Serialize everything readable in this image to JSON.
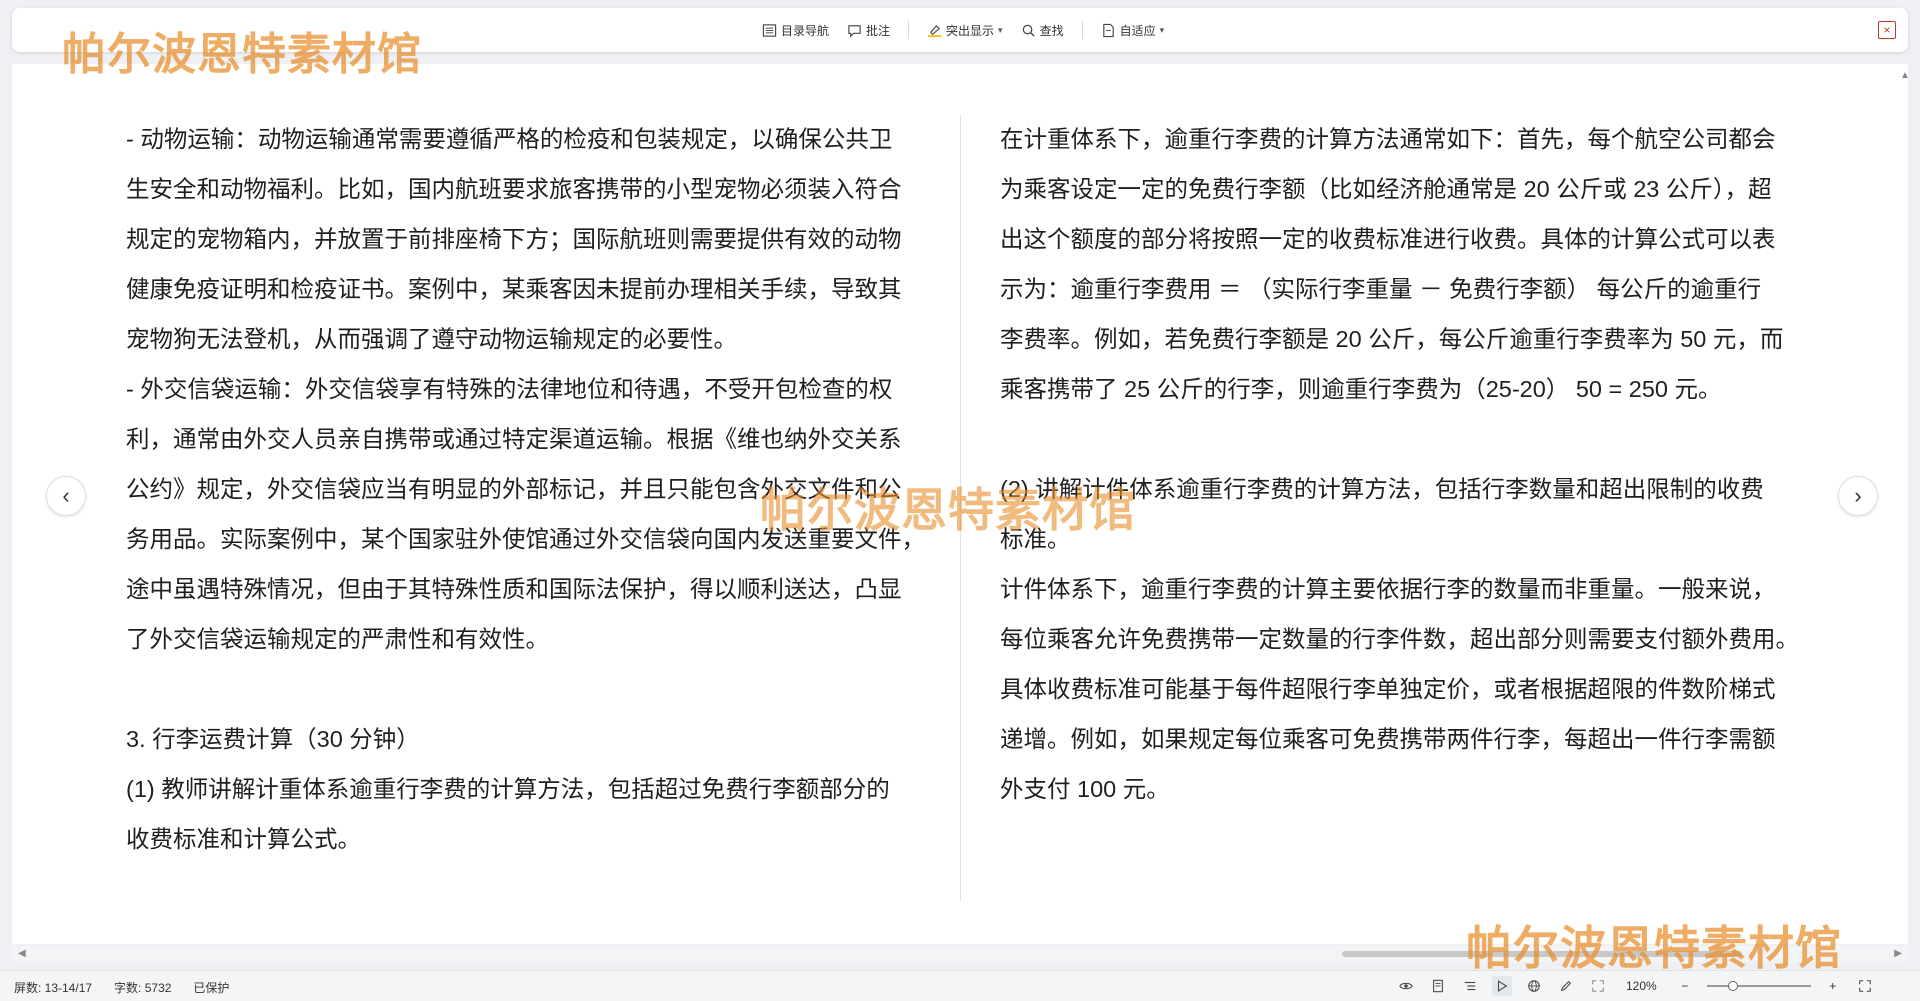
{
  "toolbar": {
    "items": [
      {
        "label": "目录导航",
        "icon": "toc-icon"
      },
      {
        "label": "批注",
        "icon": "comment-icon"
      },
      {
        "label": "突出显示",
        "icon": "highlighter-icon",
        "dropdown": true
      },
      {
        "label": "查找",
        "icon": "search-icon"
      },
      {
        "label": "自适应",
        "icon": "fit-page-icon",
        "dropdown": true
      }
    ],
    "close_label": "×"
  },
  "watermark": {
    "text": "帕尔波恩特素材馆",
    "color": "#e88c28"
  },
  "document": {
    "left_column": [
      "- 动物运输：动物运输通常需要遵循严格的检疫和包装规定，以确保公共卫",
      "生安全和动物福利。比如，国内航班要求旅客携带的小型宠物必须装入符合",
      "规定的宠物箱内，并放置于前排座椅下方；国际航班则需要提供有效的动物",
      "健康免疫证明和检疫证书。案例中，某乘客因未提前办理相关手续，导致其",
      "宠物狗无法登机，从而强调了遵守动物运输规定的必要性。",
      "- 外交信袋运输：外交信袋享有特殊的法律地位和待遇，不受开包检查的权",
      "利，通常由外交人员亲自携带或通过特定渠道运输。根据《维也纳外交关系",
      "公约》规定，外交信袋应当有明显的外部标记，并且只能包含外交文件和公",
      "务用品。实际案例中，某个国家驻外使馆通过外交信袋向国内发送重要文件，",
      "途中虽遇特殊情况，但由于其特殊性质和国际法保护，得以顺利送达，凸显",
      "了外交信袋运输规定的严肃性和有效性。",
      "",
      "3. 行李运费计算（30 分钟）",
      "(1) 教师讲解计重体系逾重行李费的计算方法，包括超过免费行李额部分的",
      "收费标准和计算公式。"
    ],
    "right_column": [
      "在计重体系下，逾重行李费的计算方法通常如下：首先，每个航空公司都会",
      "为乘客设定一定的免费行李额（比如经济舱通常是 20 公斤或 23 公斤），超",
      "出这个额度的部分将按照一定的收费标准进行收费。具体的计算公式可以表",
      "示为：逾重行李费用 ＝ （实际行李重量 － 免费行李额） 每公斤的逾重行",
      "李费率。例如，若免费行李额是 20 公斤，每公斤逾重行李费率为 50 元，而",
      "乘客携带了 25 公斤的行李，则逾重行李费为（25-20） 50 = 250 元。",
      "",
      "(2) 讲解计件体系逾重行李费的计算方法，包括行李数量和超出限制的收费",
      "标准。",
      "计件体系下，逾重行李费的计算主要依据行李的数量而非重量。一般来说，",
      "每位乘客允许免费携带一定数量的行李件数，超出部分则需要支付额外费用。",
      "具体收费标准可能基于每件超限行李单独定价，或者根据超限的件数阶梯式",
      "递增。例如，如果规定每位乘客可免费携带两件行李，每超出一件行李需额",
      "外支付 100 元。"
    ]
  },
  "navigation": {
    "prev_label": "‹",
    "next_label": "›"
  },
  "statusbar": {
    "page_info": "屏数: 13-14/17",
    "word_count": "字数: 5732",
    "protect_status": "已保护",
    "zoom": "120%",
    "zoom_fraction": 0.22
  }
}
